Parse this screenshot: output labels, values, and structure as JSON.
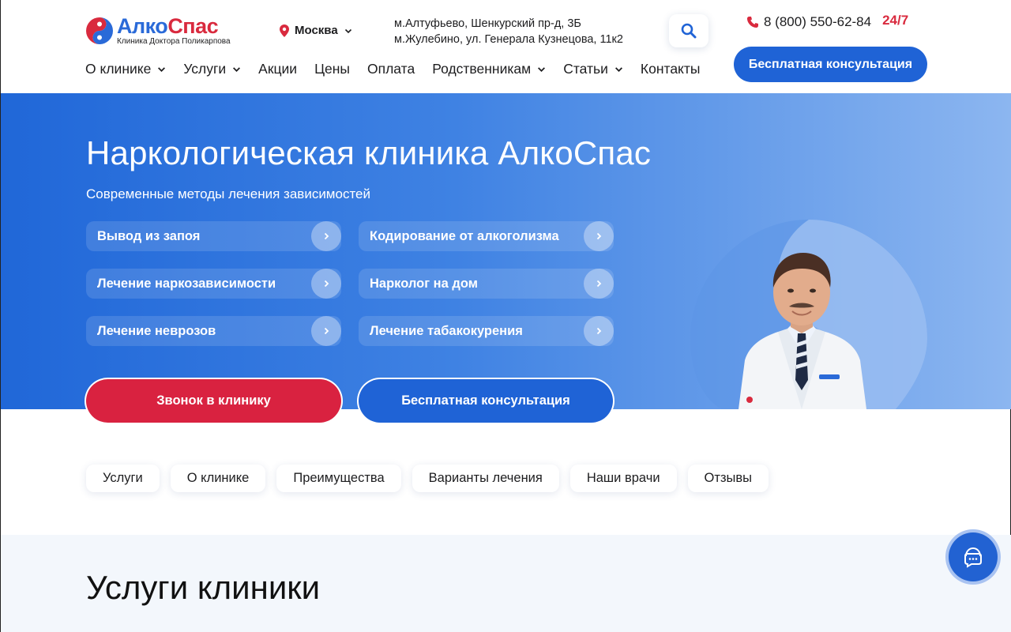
{
  "logo": {
    "alko": "Алко",
    "spas": "Спас",
    "subtitle": "Клиника Доктора Поликарпова"
  },
  "city": {
    "label": "Москва"
  },
  "addresses": [
    "м.Алтуфьево, Шенкурский пр-д, 3Б",
    "м.Жулебино, ул. Генерала Кузнецова, 11к2"
  ],
  "phone": {
    "number": "8 (800) 550-62-84",
    "hours": "24/7"
  },
  "nav": {
    "items": [
      {
        "label": "О клинике",
        "dropdown": true
      },
      {
        "label": "Услуги",
        "dropdown": true
      },
      {
        "label": "Акции",
        "dropdown": false
      },
      {
        "label": "Цены",
        "dropdown": false
      },
      {
        "label": "Оплата",
        "dropdown": false
      },
      {
        "label": "Родственникам",
        "dropdown": true
      },
      {
        "label": "Статьи",
        "dropdown": true
      },
      {
        "label": "Контакты",
        "dropdown": false
      }
    ],
    "consult_label": "Бесплатная консультация"
  },
  "hero": {
    "title": "Наркологическая клиника АлкоСпас",
    "subtitle": "Современные методы лечения зависимостей",
    "services": [
      "Вывод из запоя",
      "Кодирование от алкоголизма",
      "Лечение наркозависимости",
      "Нарколог на дом",
      "Лечение неврозов",
      "Лечение табакокурения"
    ],
    "call_label": "Звонок в клинику",
    "consult_label": "Бесплатная консультация"
  },
  "anchors": [
    "Услуги",
    "О клинике",
    "Преимущества",
    "Варианты лечения",
    "Наши врачи",
    "Отзывы"
  ],
  "services_section": {
    "title": "Услуги клиники"
  },
  "colors": {
    "brand_blue": "#1f63d6",
    "brand_red": "#d92240",
    "hero_start": "#2067d8",
    "hero_end": "#8cb6f0"
  },
  "icons": {
    "city": "map-pin-icon",
    "search": "search-icon",
    "phone": "phone-icon",
    "chat": "chat-icon"
  }
}
